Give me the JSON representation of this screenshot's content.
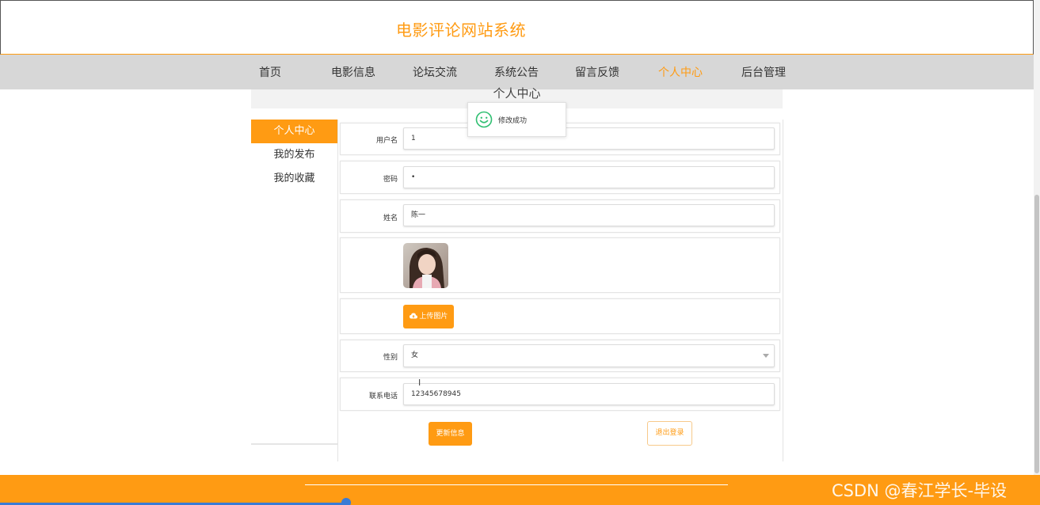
{
  "site": {
    "title": "电影评论网站系统"
  },
  "nav": {
    "items": [
      {
        "label": "首页",
        "active": false
      },
      {
        "label": "电影信息",
        "active": false
      },
      {
        "label": "论坛交流",
        "active": false
      },
      {
        "label": "系统公告",
        "active": false
      },
      {
        "label": "留言反馈",
        "active": false
      },
      {
        "label": "个人中心",
        "active": true
      },
      {
        "label": "后台管理",
        "active": false
      }
    ]
  },
  "section": {
    "title": "个人中心"
  },
  "sidebar": {
    "items": [
      {
        "label": "个人中心",
        "active": true
      },
      {
        "label": "我的发布",
        "active": false
      },
      {
        "label": "我的收藏",
        "active": false
      }
    ]
  },
  "form": {
    "username": {
      "label": "用户名",
      "value": "1"
    },
    "password": {
      "label": "密码",
      "value": "•"
    },
    "name": {
      "label": "姓名",
      "value": "陈一"
    },
    "upload": {
      "label": "上传图片",
      "icon": "cloud-upload-icon"
    },
    "gender": {
      "label": "性别",
      "value": "女"
    },
    "phone": {
      "label": "联系电话",
      "value": "12345678945"
    }
  },
  "actions": {
    "update": "更新信息",
    "logout": "退出登录"
  },
  "toast": {
    "text": "修改成功",
    "icon": "smile-icon"
  },
  "watermark": "CSDN @春江学长-毕设",
  "colors": {
    "accent": "#ff9b13",
    "nav_bg": "#d7d7d7",
    "toast_icon": "#2fbf71"
  }
}
